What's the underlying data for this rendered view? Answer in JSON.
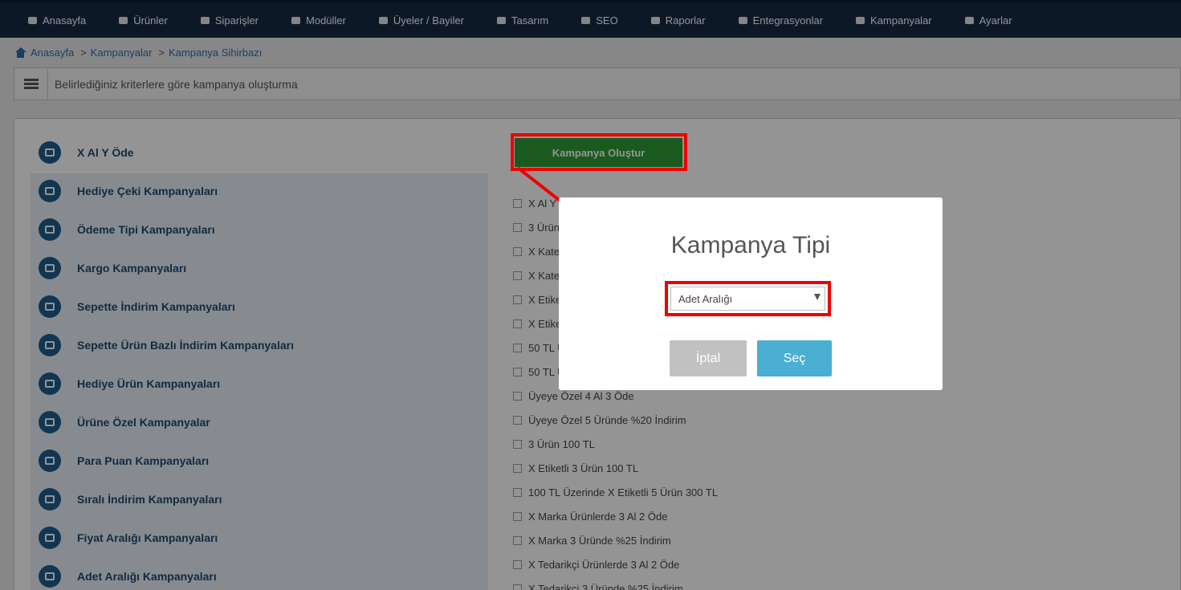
{
  "topnav": {
    "items": [
      {
        "label": "Anasayfa",
        "icon": "home-icon"
      },
      {
        "label": "Ürünler",
        "icon": "folder-icon"
      },
      {
        "label": "Siparişler",
        "icon": "list-icon"
      },
      {
        "label": "Modüller",
        "icon": "module-icon"
      },
      {
        "label": "Üyeler / Bayiler",
        "icon": "users-icon"
      },
      {
        "label": "Tasarım",
        "icon": "palette-icon"
      },
      {
        "label": "SEO",
        "icon": "rocket-icon"
      },
      {
        "label": "Raporlar",
        "icon": "chart-icon"
      },
      {
        "label": "Entegrasyonlar",
        "icon": "integration-icon"
      },
      {
        "label": "Kampanyalar",
        "icon": "campaign-icon"
      },
      {
        "label": "Ayarlar",
        "icon": "wrench-icon"
      }
    ]
  },
  "breadcrumb": {
    "items": [
      "Anasayfa",
      "Kampanyalar",
      "Kampanya Sihirbazı"
    ]
  },
  "header": {
    "text": "Belirlediğiniz kriterlere göre kampanya oluşturma"
  },
  "categories": [
    "X Al Y Öde",
    "Hediye Çeki Kampanyaları",
    "Ödeme Tipi Kampanyaları",
    "Kargo Kampanyaları",
    "Sepette İndirim Kampanyaları",
    "Sepette Ürün Bazlı İndirim Kampanyaları",
    "Hediye Ürün Kampanyaları",
    "Ürüne Özel Kampanyalar",
    "Para Puan Kampanyaları",
    "Sıralı İndirim Kampanyaları",
    "Fiyat Aralığı Kampanyaları",
    "Adet Aralığı Kampanyaları"
  ],
  "create_button": "Kampanya Oluştur",
  "options": [
    "X Al Y",
    "3 Ürün",
    "X Kate",
    "X Kate",
    "X Etike",
    "X Etike",
    "50 TL Ü",
    "50 TL Ü",
    "Üyeye Özel 4 Al 3 Öde",
    "Üyeye Özel 5 Üründe %20 İndirim",
    "3 Ürün 100 TL",
    "X Etiketli 3 Ürün 100 TL",
    "100 TL Üzerinde X Etiketli 5 Ürün 300 TL",
    "X Marka Ürünlerde 3 Al 2 Öde",
    "X Marka 3 Üründe %25 İndirim",
    "X Tedarikçi Ürünlerde 3 Al 2 Öde",
    "X Tedarikçi 3 Üründe %25 İndirim"
  ],
  "modal": {
    "title": "Kampanya Tipi",
    "selected": "Adet Aralığı",
    "cancel_label": "İptal",
    "select_label": "Seç"
  },
  "colors": {
    "nav_bg": "#172a44",
    "accent_green": "#2f9b36",
    "accent_blue": "#4aafd2",
    "highlight_red": "#ee0000",
    "category_text": "#1e4a72"
  }
}
